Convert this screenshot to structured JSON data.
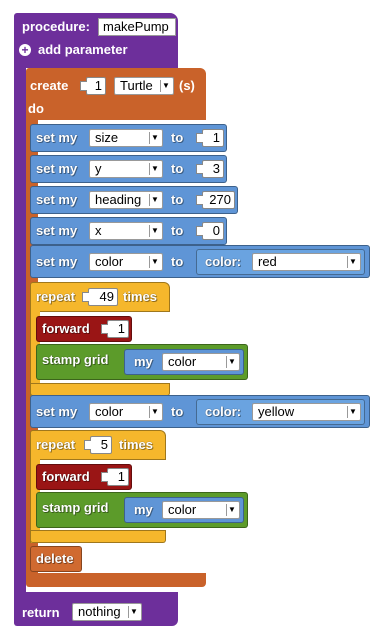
{
  "procedure": {
    "label": "procedure:",
    "name": "makePump",
    "add_param": "add parameter",
    "return_label": "return",
    "return_value": "nothing"
  },
  "create": {
    "label": "create",
    "count": "1",
    "breed": "Turtle",
    "suffix": "(s)",
    "do": "do"
  },
  "set_blocks": [
    {
      "kw": "set my",
      "prop": "size",
      "to": "to",
      "value": "1"
    },
    {
      "kw": "set my",
      "prop": "y",
      "to": "to",
      "value": "3"
    },
    {
      "kw": "set my",
      "prop": "heading",
      "to": "to",
      "value": "270"
    },
    {
      "kw": "set my",
      "prop": "x",
      "to": "to",
      "value": "0"
    },
    {
      "kw": "set my",
      "prop": "color",
      "to": "to",
      "color_label": "color:",
      "color_value": "red"
    }
  ],
  "repeat1": {
    "kw": "repeat",
    "count": "49",
    "times": "times",
    "forward": "forward",
    "forward_value": "1",
    "stamp": "stamp grid",
    "my": "my",
    "my_prop": "color"
  },
  "set_color2": {
    "kw": "set my",
    "prop": "color",
    "to": "to",
    "color_label": "color:",
    "color_value": "yellow"
  },
  "repeat2": {
    "kw": "repeat",
    "count": "5",
    "times": "times",
    "forward": "forward",
    "forward_value": "1",
    "stamp": "stamp grid",
    "my": "my",
    "my_prop": "color"
  },
  "delete_label": "delete",
  "colors": {
    "procedure": "#6d2f9b",
    "create": "#c9622a",
    "set": "#5f95d6",
    "repeat": "#f5b72c",
    "forward": "#9a1515",
    "stamp": "#5c9b2a"
  }
}
